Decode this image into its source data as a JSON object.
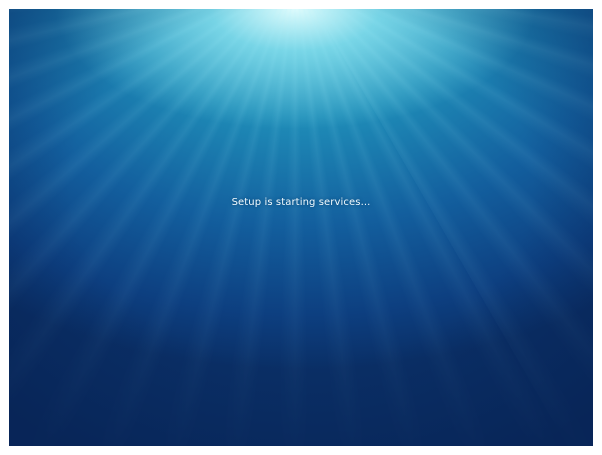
{
  "screen": {
    "status_message": "Setup is starting services...",
    "colors": {
      "top_glow": "#e6ffff",
      "mid_blue": "#1f8db8",
      "deep_blue": "#0a2f66",
      "text": "#f2fbff"
    }
  }
}
